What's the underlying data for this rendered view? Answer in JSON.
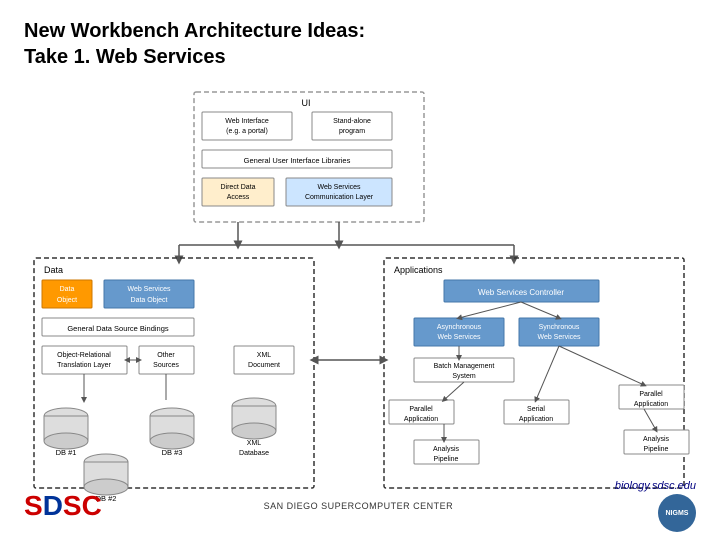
{
  "title_line1": "New Workbench Architecture Ideas:",
  "title_line2": "Take 1. Web Services",
  "footer": {
    "org": "SAN DIEGO SUPERCOMPUTER CENTER",
    "url": "biology.sdsc.edu",
    "badge": "NIGMS"
  },
  "diagram": {
    "ui_label": "UI",
    "web_interface_label": "Web Interface\n(e.g. a portal)",
    "standalone_label": "Stand-alone\nprogram",
    "gui_lib_label": "General User Interface Libraries",
    "direct_data_label": "Direct Data\nAccess",
    "ws_comm_label": "Web Services\nCommunication Layer",
    "data_label": "Data",
    "applications_label": "Applications",
    "data_object_label": "Data\nObject",
    "ws_data_object_label": "Web Services\nData Object",
    "general_ds_label": "General Data Source Bindings",
    "or_translation_label": "Object-Relational\nTranslation Layer",
    "other_sources_label": "Other\nSources",
    "xml_doc_label": "XML\nDocument",
    "db1_label": "DB #1",
    "db2_label": "DB #2",
    "db3_label": "DB #3",
    "xml_db_label": "XML\nDatabase",
    "ws_controller_label": "Web Services Controller",
    "async_ws_label": "Asynchronous\nWeb Services",
    "sync_ws_label": "Synchronous\nWeb Services",
    "batch_mgmt_label": "Batch Management\nSystem",
    "parallel_app1_label": "Parallel\nApplication",
    "serial_app_label": "Serial\nApplication",
    "parallel_app2_label": "Parallel\nApplication",
    "analysis_pipeline1_label": "Analysis\nPipeline",
    "analysis_pipeline2_label": "Analysis\nPipeline"
  }
}
